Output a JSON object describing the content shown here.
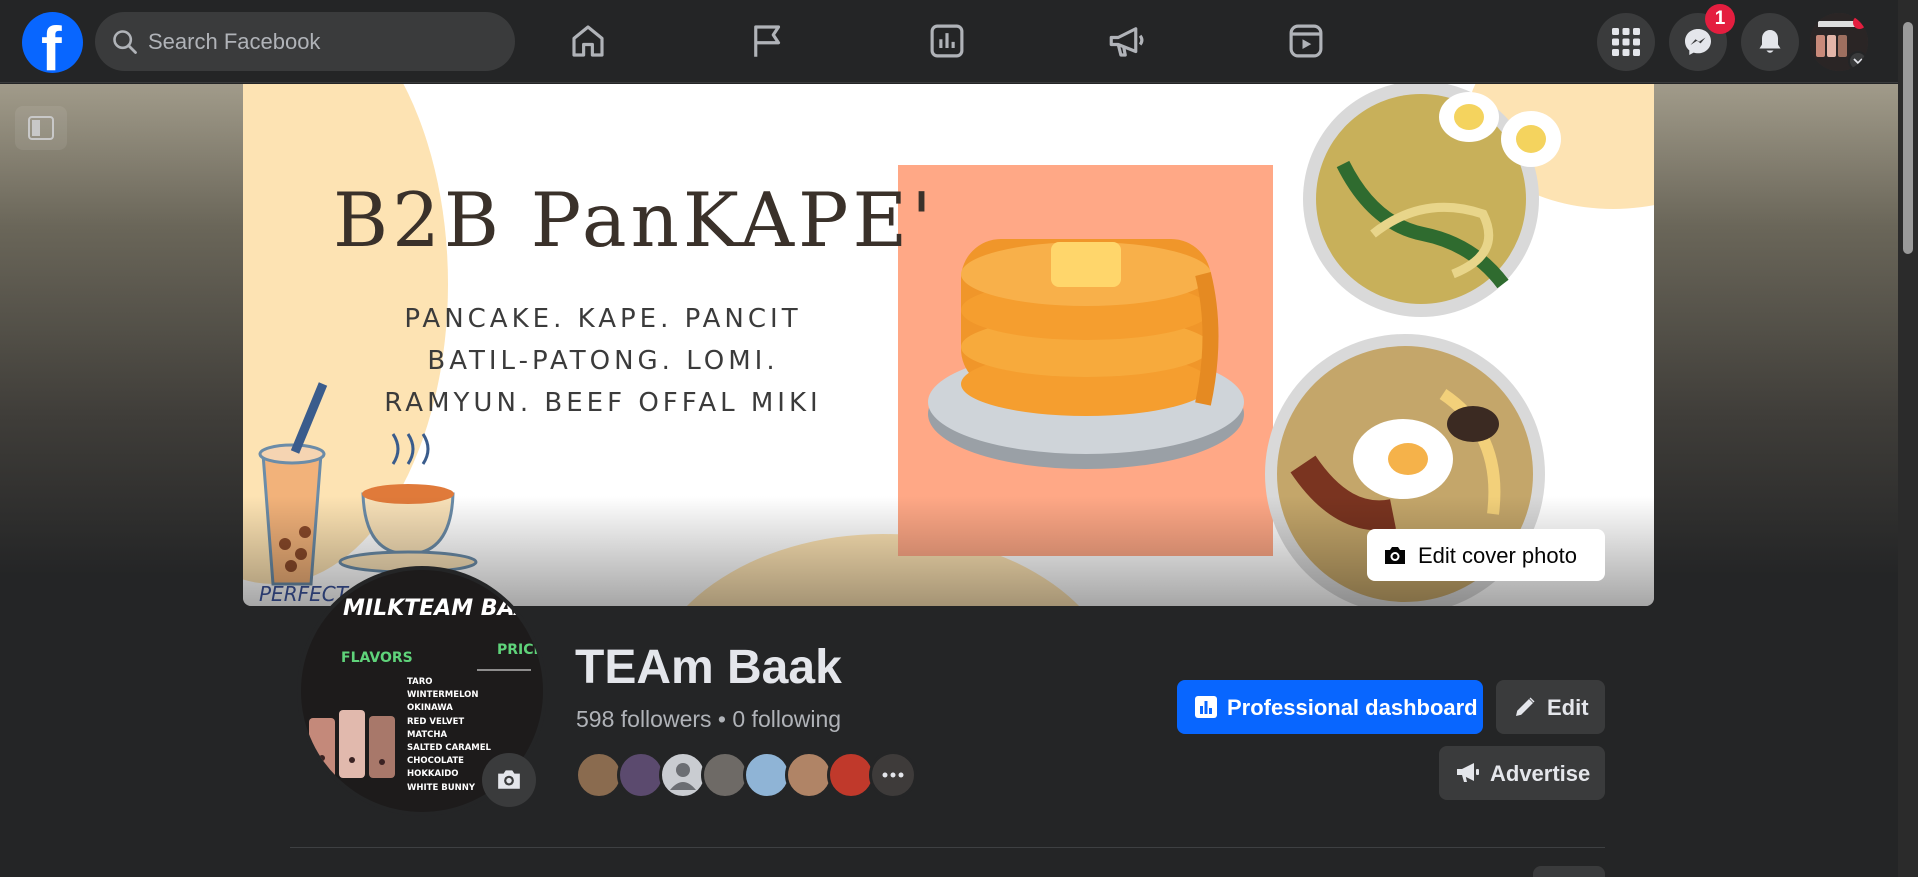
{
  "header": {
    "logo_letter": "f",
    "search": {
      "placeholder": "Search Facebook"
    },
    "nav_icons": [
      "home-icon",
      "flag-icon",
      "insights-icon",
      "megaphone-icon",
      "video-icon"
    ],
    "right_icons": [
      "menu-grid-icon",
      "messenger-icon",
      "notifications-icon"
    ],
    "messenger_badge": "1"
  },
  "cover": {
    "title": "B2B PanKAPE'",
    "lines": [
      "PANCAKE. KAPE. PANCIT",
      "BATIL-PATONG. LOMI.",
      "RAMYUN. BEEF OFFAL MIKI"
    ],
    "perfect": "PERFECT",
    "edit_label": "Edit cover photo"
  },
  "profile_picture": {
    "title": "MILKTEAM BAAK",
    "flavors_heading": "FLAVORS",
    "price_heading": "PRICE",
    "flavors": [
      "TARO",
      "WINTERMELON",
      "OKINAWA",
      "RED VELVET",
      "MATCHA",
      "SALTED CARAMEL",
      "CHOCOLATE",
      "HOKKAIDO",
      "WHITE BUNNY"
    ]
  },
  "page": {
    "name": "TEAm Baak",
    "followers_text": "598 followers",
    "separator": " • ",
    "following_text": "0 following",
    "follower_avatars": [
      "#8a6b4f",
      "#5b4a6e",
      "#c9ccd1",
      "#6e6a66",
      "#8fb4d6",
      "#b08466",
      "#c0392b",
      "#3e3b3a"
    ]
  },
  "actions": {
    "dashboard_label": "Professional dashboard",
    "edit_label": "Edit",
    "advertise_label": "Advertise"
  },
  "colors": {
    "brand": "#0866ff",
    "background": "#242526",
    "button": "#3a3b3c",
    "badge": "#e41e3f"
  }
}
